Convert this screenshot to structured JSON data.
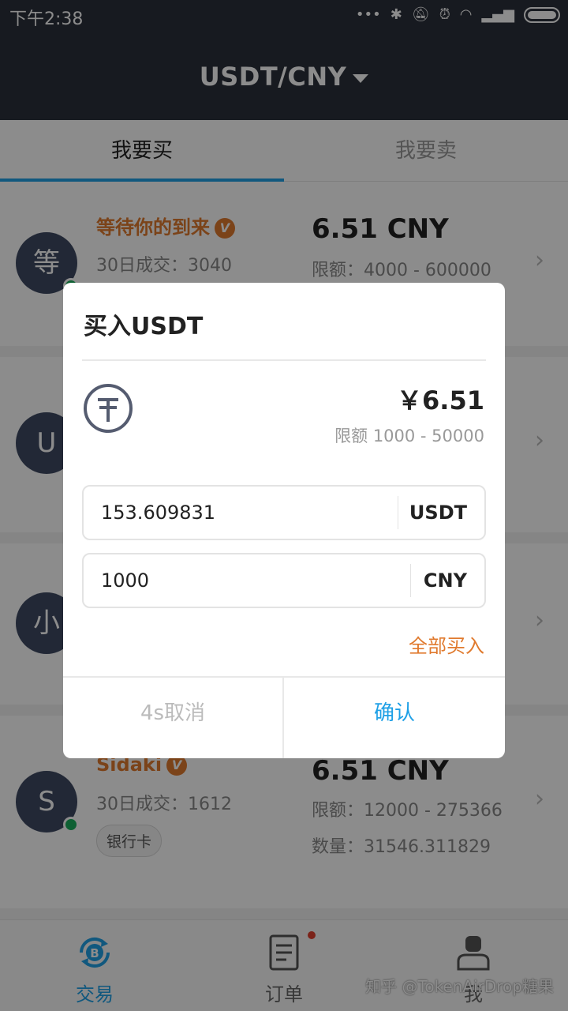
{
  "status_bar": {
    "time": "下午2:38",
    "icons": [
      "more-icon",
      "bluetooth-icon",
      "mute-icon",
      "alarm-icon",
      "wifi-icon",
      "signal-icon",
      "battery-icon"
    ]
  },
  "header": {
    "pair": "USDT/CNY"
  },
  "tabs": [
    {
      "label": "我要买",
      "active": true
    },
    {
      "label": "我要卖",
      "active": false
    }
  ],
  "listings": [
    {
      "avatar": "等",
      "merchant": "等待你的到来",
      "verified_badge": "V",
      "deals": "30日成交：3040",
      "price": "6.51 CNY",
      "limit": "限额：4000 - 600000"
    },
    {
      "avatar": "U"
    },
    {
      "avatar": "小"
    },
    {
      "avatar": "S",
      "merchant": "Sidaki",
      "verified_badge": "V",
      "deals": "30日成交：1612",
      "payment": "银行卡",
      "price": "6.51 CNY",
      "limit": "限额：12000 - 275366",
      "quantity": "数量：31546.311829"
    }
  ],
  "bottom_nav": [
    {
      "label": "交易",
      "icon": "bitcoin-exchange-icon",
      "active": true
    },
    {
      "label": "订单",
      "icon": "order-document-icon",
      "active": false,
      "has_dot": true
    },
    {
      "label": "我",
      "icon": "user-icon",
      "active": false
    }
  ],
  "watermark": "知乎 @TokenAirDrop糖果",
  "dialog": {
    "title": "买入USDT",
    "coin_icon": "tether-icon",
    "price": "￥6.51",
    "limit": "限额 1000 - 50000",
    "usdt_amount": "153.609831",
    "usdt_unit": "USDT",
    "cny_amount": "1000",
    "cny_unit": "CNY",
    "buy_all": "全部买入",
    "cancel": "4s取消",
    "confirm": "确认"
  },
  "colors": {
    "header_bg": "#2b303b",
    "accent_blue": "#1fa0e6",
    "accent_orange": "#e07a2e",
    "avatar_bg": "#3f4a63",
    "online_green": "#1aaf5d"
  }
}
